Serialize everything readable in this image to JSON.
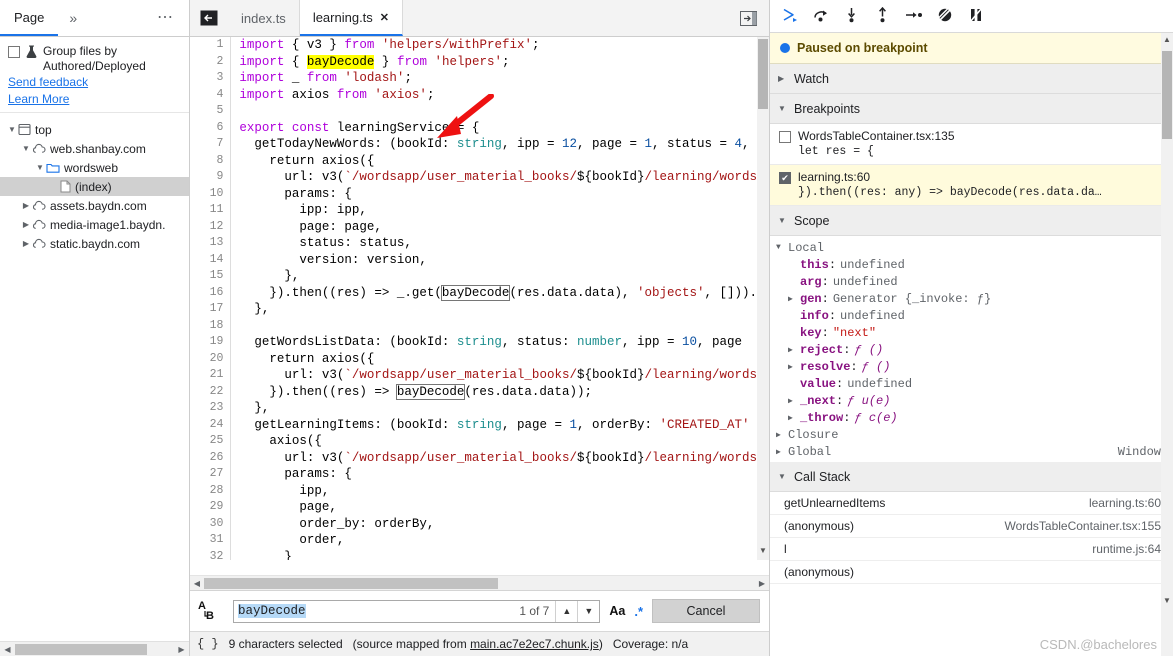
{
  "sidebar": {
    "tab_label": "Page",
    "more_tabs_icon": "chevron-double-right-icon",
    "more_options_icon": "ellipsis-icon",
    "group_files_label": "Group files by Authored/Deployed",
    "flask_icon": "flask-icon",
    "send_feedback": "Send feedback",
    "learn_more": "Learn More",
    "tree": [
      {
        "label": "top",
        "icon": "frame-icon",
        "depth": 0,
        "expanded": true,
        "selected": false
      },
      {
        "label": "web.shanbay.com",
        "icon": "cloud-icon",
        "depth": 1,
        "expanded": true,
        "selected": false
      },
      {
        "label": "wordsweb",
        "icon": "folder-icon",
        "depth": 2,
        "expanded": true,
        "selected": false
      },
      {
        "label": "(index)",
        "icon": "document-icon",
        "depth": 3,
        "expanded": null,
        "selected": true
      },
      {
        "label": "assets.baydn.com",
        "icon": "cloud-icon",
        "depth": 1,
        "expanded": false,
        "selected": false
      },
      {
        "label": "media-image1.baydn.",
        "icon": "cloud-icon",
        "depth": 1,
        "expanded": false,
        "selected": false
      },
      {
        "label": "static.baydn.com",
        "icon": "cloud-icon",
        "depth": 1,
        "expanded": false,
        "selected": false
      }
    ]
  },
  "editor": {
    "nav_back_icon": "panel-collapse-icon",
    "show_navigator_icon": "panel-expand-icon",
    "tabs": [
      {
        "label": "index.ts",
        "active": false,
        "closable": false
      },
      {
        "label": "learning.ts",
        "active": true,
        "closable": true,
        "close_icon": "close-icon"
      }
    ],
    "lines": [
      {
        "n": 1,
        "tokens": [
          {
            "t": "import ",
            "c": "kw"
          },
          {
            "t": "{ v3 } ",
            "c": "pln"
          },
          {
            "t": "from ",
            "c": "kw"
          },
          {
            "t": "'helpers/withPrefix'",
            "c": "str"
          },
          {
            "t": ";",
            "c": "pln"
          }
        ]
      },
      {
        "n": 2,
        "tokens": [
          {
            "t": "import ",
            "c": "kw"
          },
          {
            "t": "{ ",
            "c": "pln"
          },
          {
            "t": "bayDecode",
            "c": "pln hl-yellow"
          },
          {
            "t": " } ",
            "c": "pln"
          },
          {
            "t": "from ",
            "c": "kw"
          },
          {
            "t": "'helpers'",
            "c": "str"
          },
          {
            "t": ";",
            "c": "pln"
          }
        ]
      },
      {
        "n": 3,
        "tokens": [
          {
            "t": "import ",
            "c": "kw"
          },
          {
            "t": "_ ",
            "c": "pln"
          },
          {
            "t": "from ",
            "c": "kw"
          },
          {
            "t": "'lodash'",
            "c": "str"
          },
          {
            "t": ";",
            "c": "pln"
          }
        ]
      },
      {
        "n": 4,
        "tokens": [
          {
            "t": "import ",
            "c": "kw"
          },
          {
            "t": "axios ",
            "c": "pln"
          },
          {
            "t": "from ",
            "c": "kw"
          },
          {
            "t": "'axios'",
            "c": "str"
          },
          {
            "t": ";",
            "c": "pln"
          }
        ]
      },
      {
        "n": 5,
        "tokens": []
      },
      {
        "n": 6,
        "tokens": [
          {
            "t": "export const ",
            "c": "kw"
          },
          {
            "t": "learningService = {",
            "c": "pln"
          }
        ]
      },
      {
        "n": 7,
        "tokens": [
          {
            "t": "  getTodayNewWords: (bookId: ",
            "c": "pln"
          },
          {
            "t": "string",
            "c": "typ"
          },
          {
            "t": ", ipp = ",
            "c": "pln"
          },
          {
            "t": "12",
            "c": "num"
          },
          {
            "t": ", page = ",
            "c": "pln"
          },
          {
            "t": "1",
            "c": "num"
          },
          {
            "t": ", status = ",
            "c": "pln"
          },
          {
            "t": "4",
            "c": "num"
          },
          {
            "t": ",",
            "c": "pln"
          }
        ]
      },
      {
        "n": 8,
        "tokens": [
          {
            "t": "    return axios({",
            "c": "pln"
          }
        ]
      },
      {
        "n": 9,
        "tokens": [
          {
            "t": "      url: v3(",
            "c": "pln"
          },
          {
            "t": "`/wordsapp/user_material_books/",
            "c": "str"
          },
          {
            "t": "${bookId}",
            "c": "pln"
          },
          {
            "t": "/learning/words",
            "c": "str"
          }
        ]
      },
      {
        "n": 10,
        "tokens": [
          {
            "t": "      params: {",
            "c": "pln"
          }
        ]
      },
      {
        "n": 11,
        "tokens": [
          {
            "t": "        ipp: ipp,",
            "c": "pln"
          }
        ]
      },
      {
        "n": 12,
        "tokens": [
          {
            "t": "        page: page,",
            "c": "pln"
          }
        ]
      },
      {
        "n": 13,
        "tokens": [
          {
            "t": "        status: status,",
            "c": "pln"
          }
        ]
      },
      {
        "n": 14,
        "tokens": [
          {
            "t": "        version: version,",
            "c": "pln"
          }
        ]
      },
      {
        "n": 15,
        "tokens": [
          {
            "t": "      },",
            "c": "pln"
          }
        ]
      },
      {
        "n": 16,
        "tokens": [
          {
            "t": "    }).then((res) => _.get(",
            "c": "pln"
          },
          {
            "t": "bayDecode",
            "c": "pln hl-box"
          },
          {
            "t": "(res.data.data), ",
            "c": "pln"
          },
          {
            "t": "'objects'",
            "c": "str"
          },
          {
            "t": ", [])).",
            "c": "pln"
          }
        ]
      },
      {
        "n": 17,
        "tokens": [
          {
            "t": "  },",
            "c": "pln"
          }
        ]
      },
      {
        "n": 18,
        "tokens": []
      },
      {
        "n": 19,
        "tokens": [
          {
            "t": "  getWordsListData: (bookId: ",
            "c": "pln"
          },
          {
            "t": "string",
            "c": "typ"
          },
          {
            "t": ", status: ",
            "c": "pln"
          },
          {
            "t": "number",
            "c": "typ"
          },
          {
            "t": ", ipp = ",
            "c": "pln"
          },
          {
            "t": "10",
            "c": "num"
          },
          {
            "t": ", page ",
            "c": "pln"
          }
        ]
      },
      {
        "n": 20,
        "tokens": [
          {
            "t": "    return axios({",
            "c": "pln"
          }
        ]
      },
      {
        "n": 21,
        "tokens": [
          {
            "t": "      url: v3(",
            "c": "pln"
          },
          {
            "t": "`/wordsapp/user_material_books/",
            "c": "str"
          },
          {
            "t": "${bookId}",
            "c": "pln"
          },
          {
            "t": "/learning/words",
            "c": "str"
          }
        ]
      },
      {
        "n": 22,
        "tokens": [
          {
            "t": "    }).then((res) => ",
            "c": "pln"
          },
          {
            "t": "bayDecode",
            "c": "pln hl-box"
          },
          {
            "t": "(res.data.data));",
            "c": "pln"
          }
        ]
      },
      {
        "n": 23,
        "tokens": [
          {
            "t": "  },",
            "c": "pln"
          }
        ]
      },
      {
        "n": 24,
        "tokens": [
          {
            "t": "  getLearningItems: (bookId: ",
            "c": "pln"
          },
          {
            "t": "string",
            "c": "typ"
          },
          {
            "t": ", page = ",
            "c": "pln"
          },
          {
            "t": "1",
            "c": "num"
          },
          {
            "t": ", orderBy: ",
            "c": "pln"
          },
          {
            "t": "'CREATED_AT'",
            "c": "str"
          }
        ]
      },
      {
        "n": 25,
        "tokens": [
          {
            "t": "    axios({",
            "c": "pln"
          }
        ]
      },
      {
        "n": 26,
        "tokens": [
          {
            "t": "      url: v3(",
            "c": "pln"
          },
          {
            "t": "`/wordsapp/user_material_books/",
            "c": "str"
          },
          {
            "t": "${bookId}",
            "c": "pln"
          },
          {
            "t": "/learning/words",
            "c": "str"
          }
        ]
      },
      {
        "n": 27,
        "tokens": [
          {
            "t": "      params: {",
            "c": "pln"
          }
        ]
      },
      {
        "n": 28,
        "tokens": [
          {
            "t": "        ipp,",
            "c": "pln"
          }
        ]
      },
      {
        "n": 29,
        "tokens": [
          {
            "t": "        page,",
            "c": "pln"
          }
        ]
      },
      {
        "n": 30,
        "tokens": [
          {
            "t": "        order_by: orderBy,",
            "c": "pln"
          }
        ]
      },
      {
        "n": 31,
        "tokens": [
          {
            "t": "        order,",
            "c": "pln"
          }
        ]
      },
      {
        "n": 32,
        "tokens": [
          {
            "t": "      }",
            "c": "pln"
          }
        ]
      }
    ]
  },
  "find": {
    "match_case_sensitive_icon": "replace-icon",
    "value": "bayDecode",
    "count": "1 of 7",
    "prev_icon": "chevron-up-icon",
    "next_icon": "chevron-down-icon",
    "match_case_label": "Aa",
    "regex_label": ".*",
    "cancel_label": "Cancel"
  },
  "status": {
    "format_icon": "{ }",
    "selection": "9 characters selected",
    "source_map_prefix": "(source mapped from",
    "source_map_file": "main.ac7e2ec7.chunk.js",
    "source_map_suffix": ")",
    "coverage": "Coverage: n/a"
  },
  "debugger": {
    "toolbar": [
      {
        "name": "resume-button",
        "icon": "resume-icon",
        "color": "#1a73e8"
      },
      {
        "name": "step-over-button",
        "icon": "step-over-icon",
        "color": "#202124"
      },
      {
        "name": "step-into-button",
        "icon": "step-into-icon",
        "color": "#202124"
      },
      {
        "name": "step-out-button",
        "icon": "step-out-icon",
        "color": "#202124"
      },
      {
        "name": "step-button",
        "icon": "step-icon",
        "color": "#202124"
      },
      {
        "name": "deactivate-breakpoints-button",
        "icon": "deactivate-breakpoints-icon",
        "color": "#202124"
      },
      {
        "name": "pause-on-exceptions-button",
        "icon": "pause-on-exceptions-icon",
        "color": "#202124"
      }
    ],
    "paused_label": "Paused on breakpoint",
    "watch_label": "Watch",
    "breakpoints_label": "Breakpoints",
    "breakpoints": [
      {
        "checked": false,
        "location": "WordsTableContainer.tsx:135",
        "source": "let res = {",
        "active": false
      },
      {
        "checked": true,
        "location": "learning.ts:60",
        "source": "}).then((res: any) => bayDecode(res.data.da…",
        "active": true
      }
    ],
    "scope_label": "Scope",
    "scope": [
      {
        "twisty": true,
        "name": "Local",
        "plain": true,
        "value": "",
        "indent": 0
      },
      {
        "twisty": false,
        "name": "this",
        "plain": false,
        "value": "undefined",
        "indent": 1
      },
      {
        "twisty": false,
        "name": "arg",
        "plain": false,
        "value": "undefined",
        "indent": 1
      },
      {
        "twisty": true,
        "name": "gen",
        "plain": false,
        "value": "Generator {_invoke: ƒ}",
        "indent": 1
      },
      {
        "twisty": false,
        "name": "info",
        "plain": false,
        "value": "undefined",
        "indent": 1
      },
      {
        "twisty": false,
        "name": "key",
        "plain": false,
        "value": "\"next\"",
        "indent": 1,
        "vclass": "str"
      },
      {
        "twisty": true,
        "name": "reject",
        "plain": false,
        "value": "ƒ ()",
        "indent": 1,
        "vclass": "fn"
      },
      {
        "twisty": true,
        "name": "resolve",
        "plain": false,
        "value": "ƒ ()",
        "indent": 1,
        "vclass": "fn"
      },
      {
        "twisty": false,
        "name": "value",
        "plain": false,
        "value": "undefined",
        "indent": 1
      },
      {
        "twisty": true,
        "name": "_next",
        "plain": false,
        "value": "ƒ u(e)",
        "indent": 1,
        "vclass": "fn"
      },
      {
        "twisty": true,
        "name": "_throw",
        "plain": false,
        "value": "ƒ c(e)",
        "indent": 1,
        "vclass": "fn"
      },
      {
        "twisty": true,
        "name": "Closure",
        "plain": true,
        "value": "",
        "indent": 0
      },
      {
        "twisty": true,
        "name": "Global",
        "plain": true,
        "value": "",
        "indent": 0,
        "right": "Window"
      }
    ],
    "call_stack_label": "Call Stack",
    "call_stack": [
      {
        "fn": "getUnlearnedItems",
        "file": "learning.ts:60"
      },
      {
        "fn": "(anonymous)",
        "file": "WordsTableContainer.tsx:155"
      },
      {
        "fn": "l",
        "file": "runtime.js:64"
      },
      {
        "fn": "(anonymous)",
        "file": ""
      }
    ]
  },
  "watermark": "CSDN.@bachelores"
}
